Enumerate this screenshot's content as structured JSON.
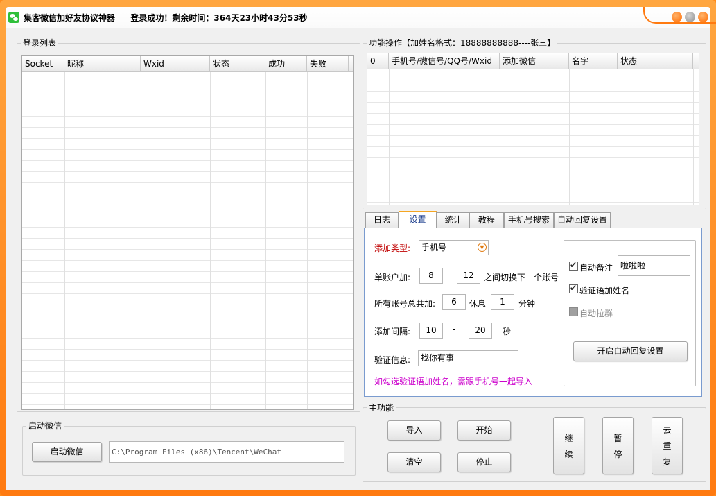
{
  "window": {
    "title": "集客微信加好友协议神器",
    "status": "登录成功！剩余时间：364天23小时43分53秒"
  },
  "login_list": {
    "label": "登录列表",
    "columns": [
      "Socket",
      "昵称",
      "Wxid",
      "状态",
      "成功",
      "失败"
    ]
  },
  "start_wechat": {
    "label": "启动微信",
    "button_label": "启动微信",
    "path_value": "C:\\Program Files (x86)\\Tencent\\WeChat"
  },
  "function_ops": {
    "label": "功能操作【加姓名格式：18888888888----张三】",
    "columns": [
      "0",
      "手机号/微信号/QQ号/Wxid",
      "添加微信",
      "名字",
      "状态"
    ]
  },
  "tabs": [
    {
      "label": "日志"
    },
    {
      "label": "设置"
    },
    {
      "label": "统计"
    },
    {
      "label": "教程"
    },
    {
      "label": "手机号搜索"
    },
    {
      "label": "自动回复设置"
    }
  ],
  "settings": {
    "add_type_label": "添加类型:",
    "add_type_value": "手机号",
    "per_account_label": "单账户加:",
    "per_account_min": "8",
    "per_account_dash": "-",
    "per_account_max": "12",
    "per_account_suffix": "之间切换下一个账号",
    "total_label": "所有账号总共加:",
    "total_value": "6",
    "rest_label": "休息",
    "rest_value": "1",
    "rest_unit": "分钟",
    "interval_label": "添加间隔:",
    "interval_min": "10",
    "interval_dash": "-",
    "interval_max": "20",
    "interval_unit": "秒",
    "verify_label": "验证信息:",
    "verify_value": "找你有事",
    "hint": "如勾选验证语加姓名，需跟手机号一起导入",
    "auto_remark_label": "自动备注",
    "auto_remark_value": "啦啦啦",
    "verify_name_label": "验证语加姓名",
    "auto_group_label": "自动拉群",
    "auto_reply_button": "开启自动回复设置"
  },
  "main_function": {
    "label": "主功能",
    "import": "导入",
    "start": "开始",
    "clear": "清空",
    "stop": "停止",
    "continue": [
      "继",
      "续"
    ],
    "pause": [
      "暂",
      "停"
    ],
    "dedupe": [
      "去",
      "重",
      "复"
    ]
  },
  "colors": {
    "frame": "#ff8a1a",
    "add_type_label": "#c00000",
    "hint": "#cc00cc",
    "active_tab_text": "#1a3c8c"
  }
}
